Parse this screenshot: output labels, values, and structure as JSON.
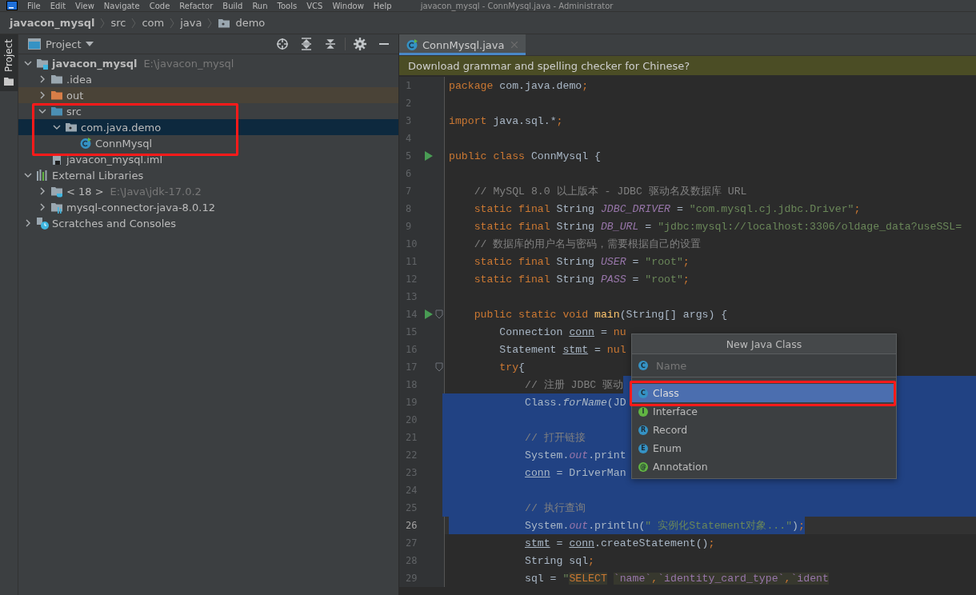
{
  "menu": [
    "File",
    "Edit",
    "View",
    "Navigate",
    "Code",
    "Refactor",
    "Build",
    "Run",
    "Tools",
    "VCS",
    "Window",
    "Help"
  ],
  "window_title": "javacon_mysql - ConnMysql.java - Administrator",
  "breadcrumb": [
    {
      "label": "javacon_mysql",
      "kind": "project"
    },
    {
      "label": "src",
      "kind": "dir"
    },
    {
      "label": "com",
      "kind": "dir"
    },
    {
      "label": "java",
      "kind": "dir"
    },
    {
      "label": "demo",
      "kind": "package"
    }
  ],
  "tool_stripe": {
    "label": "Project"
  },
  "project_panel": {
    "title": "Project",
    "tree": [
      {
        "label": "javacon_mysql",
        "hint": "E:\\javacon_mysql",
        "kind": "module",
        "expanded": true,
        "selected": false,
        "children": [
          {
            "label": ".idea",
            "kind": "folder",
            "expanded": false,
            "selected": false
          },
          {
            "label": "out",
            "kind": "excluded",
            "expanded": false,
            "selected": false
          },
          {
            "label": "src",
            "kind": "source",
            "expanded": true,
            "selected": false,
            "children": [
              {
                "label": "com.java.demo",
                "kind": "package",
                "expanded": true,
                "selected": true,
                "children": [
                  {
                    "label": "ConnMysql",
                    "kind": "class",
                    "selected": false
                  }
                ]
              }
            ]
          },
          {
            "label": "javacon_mysql.iml",
            "kind": "iml",
            "selected": false
          }
        ]
      },
      {
        "label": "External Libraries",
        "kind": "libraries",
        "expanded": true,
        "selected": false,
        "children": [
          {
            "label": "< 18 >",
            "hint": "E:\\Java\\jdk-17.0.2",
            "kind": "jdk",
            "expanded": false,
            "selected": false
          },
          {
            "label": "mysql-connector-java-8.0.12",
            "kind": "jar",
            "expanded": false,
            "selected": false
          }
        ]
      },
      {
        "label": "Scratches and Consoles",
        "kind": "scratches",
        "expanded": false,
        "selected": false
      }
    ]
  },
  "editor": {
    "tabs": [
      {
        "label": "ConnMysql.java",
        "selected": true
      }
    ],
    "notification": "Download grammar and spelling checker for Chinese?",
    "lines": [
      {
        "number": "1",
        "selected": false,
        "tokens": [
          {
            "text": "package",
            "kind": "keyword"
          },
          {
            "text": " com.java.demo",
            "kind": "plain"
          },
          {
            "text": ";",
            "kind": "keyword"
          }
        ]
      },
      {
        "number": "2",
        "selected": false
      },
      {
        "number": "3",
        "selected": false,
        "tokens": [
          {
            "text": "import",
            "kind": "keyword"
          },
          {
            "text": " java.sql.*",
            "kind": "plain"
          },
          {
            "text": ";",
            "kind": "keyword"
          }
        ]
      },
      {
        "number": "4",
        "selected": false
      },
      {
        "number": "5",
        "selected": false,
        "run": true,
        "tokens": [
          {
            "text": "public class",
            "kind": "keyword"
          },
          {
            "text": " ConnMysql {",
            "kind": "plain"
          }
        ]
      },
      {
        "number": "6",
        "selected": false
      },
      {
        "number": "7",
        "selected": false,
        "tokens": [
          {
            "text": "    // MySQL 8.0 以上版本 - JDBC 驱动名及数据库 URL",
            "kind": "comment"
          }
        ]
      },
      {
        "number": "8",
        "selected": false,
        "tokens": [
          {
            "text": "    static final",
            "kind": "keyword"
          },
          {
            "text": " String ",
            "kind": "plain"
          },
          {
            "text": "JDBC_DRIVER",
            "kind": "field"
          },
          {
            "text": " = ",
            "kind": "plain"
          },
          {
            "text": "\"com.mysql.cj.jdbc.Driver\"",
            "kind": "string"
          },
          {
            "text": ";",
            "kind": "keyword"
          }
        ]
      },
      {
        "number": "9",
        "selected": false,
        "tokens": [
          {
            "text": "    static final",
            "kind": "keyword"
          },
          {
            "text": " String ",
            "kind": "plain"
          },
          {
            "text": "DB_URL",
            "kind": "field"
          },
          {
            "text": " = ",
            "kind": "plain"
          },
          {
            "text": "\"jdbc:mysql://localhost:3306/oldage_data?useSSL=",
            "kind": "string"
          }
        ]
      },
      {
        "number": "10",
        "selected": false,
        "tokens": [
          {
            "text": "    // 数据库的用户名与密码，需要根据自己的设置",
            "kind": "comment"
          }
        ]
      },
      {
        "number": "11",
        "selected": false,
        "tokens": [
          {
            "text": "    static final",
            "kind": "keyword"
          },
          {
            "text": " String ",
            "kind": "plain"
          },
          {
            "text": "USER",
            "kind": "field"
          },
          {
            "text": " = ",
            "kind": "plain"
          },
          {
            "text": "\"root\"",
            "kind": "string"
          },
          {
            "text": ";",
            "kind": "keyword"
          }
        ]
      },
      {
        "number": "12",
        "selected": false,
        "tokens": [
          {
            "text": "    static final",
            "kind": "keyword"
          },
          {
            "text": " String ",
            "kind": "plain"
          },
          {
            "text": "PASS",
            "kind": "field"
          },
          {
            "text": " = ",
            "kind": "plain"
          },
          {
            "text": "\"root\"",
            "kind": "string"
          },
          {
            "text": ";",
            "kind": "keyword"
          }
        ]
      },
      {
        "number": "13",
        "selected": false
      },
      {
        "number": "14",
        "selected": false,
        "run": true,
        "fold": true,
        "tokens": [
          {
            "text": "    public static void ",
            "kind": "keyword"
          },
          {
            "text": "main",
            "kind": "method"
          },
          {
            "text": "(String[] args) {",
            "kind": "plain"
          }
        ]
      },
      {
        "number": "15",
        "selected": false,
        "tokens": [
          {
            "text": "        Connection ",
            "kind": "plain"
          },
          {
            "text": "conn",
            "kind": "variable"
          },
          {
            "text": " = ",
            "kind": "plain"
          },
          {
            "text": "nu",
            "kind": "keyword"
          }
        ]
      },
      {
        "number": "16",
        "selected": false,
        "tokens": [
          {
            "text": "        Statement ",
            "kind": "plain"
          },
          {
            "text": "stmt",
            "kind": "variable"
          },
          {
            "text": " = ",
            "kind": "plain"
          },
          {
            "text": "nul",
            "kind": "keyword"
          }
        ]
      },
      {
        "number": "17",
        "selected": false,
        "fold": true,
        "tokens": [
          {
            "text": "        try",
            "kind": "keyword"
          },
          {
            "text": "{",
            "kind": "plain"
          }
        ]
      },
      {
        "number": "18",
        "selected": true,
        "selection_starts_after_text": true,
        "tokens": [
          {
            "text": "            // 注册 JDBC 驱动",
            "kind": "comment"
          }
        ]
      },
      {
        "number": "19",
        "selected": true,
        "tokens": [
          {
            "text": "            Class.",
            "kind": "plain"
          },
          {
            "text": "forName",
            "kind": "static"
          },
          {
            "text": "(JD",
            "kind": "plain"
          }
        ]
      },
      {
        "number": "20",
        "selected": true
      },
      {
        "number": "21",
        "selected": true,
        "tokens": [
          {
            "text": "            // 打开链接",
            "kind": "comment"
          }
        ]
      },
      {
        "number": "22",
        "selected": true,
        "tokens": [
          {
            "text": "            System.",
            "kind": "plain"
          },
          {
            "text": "out",
            "kind": "field"
          },
          {
            "text": ".print",
            "kind": "plain"
          }
        ]
      },
      {
        "number": "23",
        "selected": true,
        "tokens": [
          {
            "text": "            conn",
            "kind": "variable"
          },
          {
            "text": " = DriverMan",
            "kind": "plain"
          }
        ]
      },
      {
        "number": "24",
        "selected": true
      },
      {
        "number": "25",
        "selected": true,
        "tokens": [
          {
            "text": "            // 执行查询",
            "kind": "comment"
          }
        ]
      },
      {
        "number": "26",
        "selected": true,
        "selection_ends_at_text": true,
        "current": true,
        "tokens": [
          {
            "text": "            System.",
            "kind": "plain"
          },
          {
            "text": "out",
            "kind": "field"
          },
          {
            "text": ".println(",
            "kind": "plain"
          },
          {
            "text": "\" 实例化Statement对象...\"",
            "kind": "string"
          },
          {
            "text": ")",
            "kind": "plain"
          },
          {
            "text": ";",
            "kind": "keyword"
          }
        ]
      },
      {
        "number": "27",
        "selected": false,
        "tokens": [
          {
            "text": "            stmt",
            "kind": "variable"
          },
          {
            "text": " = ",
            "kind": "plain"
          },
          {
            "text": "conn",
            "kind": "variable"
          },
          {
            "text": ".createStatement()",
            "kind": "plain"
          },
          {
            "text": ";",
            "kind": "keyword"
          }
        ]
      },
      {
        "number": "28",
        "selected": false,
        "tokens": [
          {
            "text": "            String sql",
            "kind": "plain"
          },
          {
            "text": ";",
            "kind": "keyword"
          }
        ]
      },
      {
        "number": "29",
        "selected": false,
        "tokens": [
          {
            "text": "            sql = ",
            "kind": "plain"
          },
          {
            "text": "\"",
            "kind": "string"
          },
          {
            "text": "SELECT",
            "kind": "sql-keyword"
          },
          {
            "text": " `name`",
            "kind": "sql-name"
          },
          {
            "text": ",",
            "kind": "sql-punct"
          },
          {
            "text": "`identity_card_type`",
            "kind": "sql-name"
          },
          {
            "text": ",",
            "kind": "sql-punct"
          },
          {
            "text": "`ident",
            "kind": "sql-name"
          }
        ]
      }
    ]
  },
  "popup": {
    "title": "New Java Class",
    "field": {
      "placeholder": "Name",
      "badge": "C",
      "color": "#3592c4"
    },
    "items": [
      {
        "label": "Class",
        "badge": "C",
        "color": "#3592c4",
        "selected": true
      },
      {
        "label": "Interface",
        "badge": "I",
        "color": "#62b543",
        "selected": false
      },
      {
        "label": "Record",
        "badge": "R",
        "color": "#3592c4",
        "selected": false
      },
      {
        "label": "Enum",
        "badge": "E",
        "color": "#3592c4",
        "selected": false
      },
      {
        "label": "Annotation",
        "badge": "@",
        "color": "#62b543",
        "selected": false
      }
    ]
  }
}
